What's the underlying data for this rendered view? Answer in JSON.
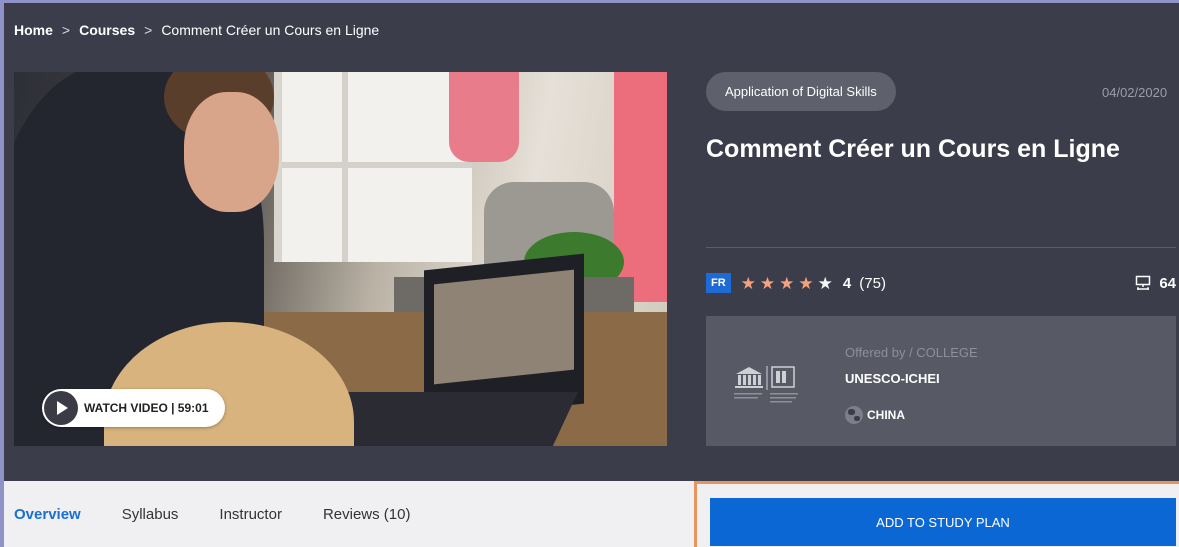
{
  "breadcrumb": {
    "items": [
      "Home",
      "Courses",
      "Comment Créer un Cours en Ligne"
    ],
    "separator": ">"
  },
  "video": {
    "watch_label": "WATCH VIDEO | 59:01"
  },
  "course": {
    "category": "Application of Digital Skills",
    "date": "04/02/2020",
    "title": "Comment Créer un Cours en Ligne",
    "language": "FR",
    "rating_value": "4",
    "rating_stars": 4.5,
    "rating_count": "(75)",
    "lessons_count": "64"
  },
  "provider": {
    "offered_by": "Offered by / COLLEGE",
    "name": "UNESCO-ICHEI",
    "country": "CHINA"
  },
  "tabs": [
    {
      "label": "Overview"
    },
    {
      "label": "Syllabus"
    },
    {
      "label": "Instructor"
    },
    {
      "label": "Reviews (10)"
    }
  ],
  "cta": {
    "label": "ADD TO STUDY PLAN"
  },
  "colors": {
    "hero_bg": "#3b3d4b",
    "accent_blue": "#0a67d4",
    "star": "#f5a27a",
    "highlight_border": "#e6955e"
  },
  "icons": {
    "play": "play-icon",
    "star": "star-icon",
    "lessons": "presentation-icon",
    "globe": "globe-icon"
  }
}
